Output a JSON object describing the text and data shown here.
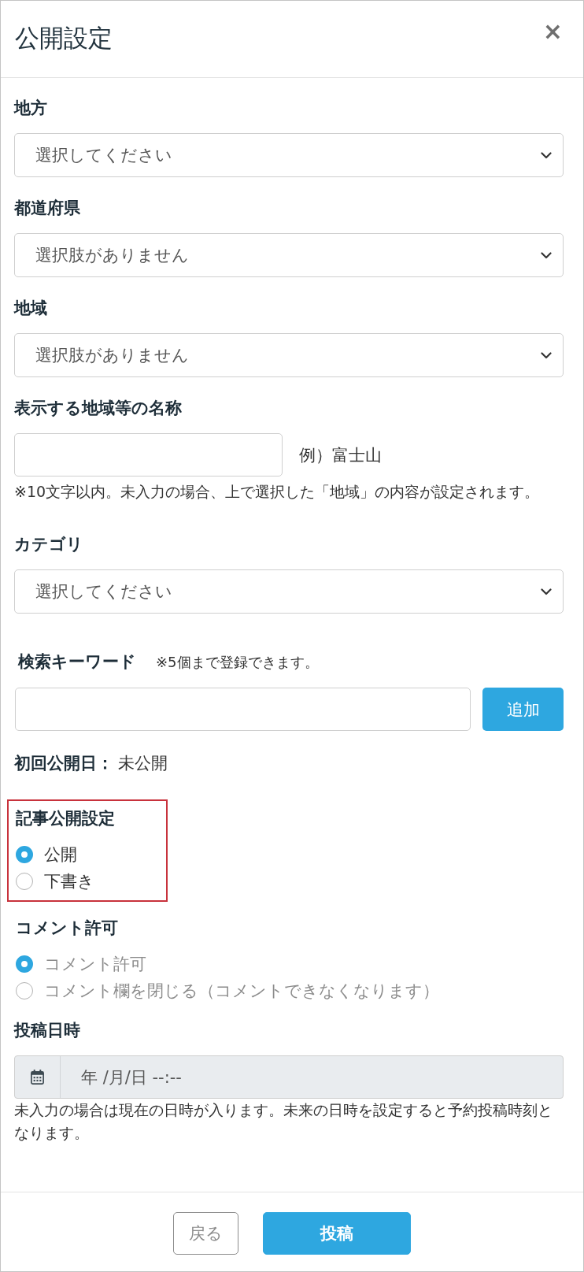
{
  "dialog": {
    "title": "公開設定",
    "close": "×"
  },
  "fields": [
    {
      "kind": "select",
      "label": "地方",
      "value": "選択してください"
    },
    {
      "kind": "select",
      "label": "都道府県",
      "value": "選択肢がありません"
    },
    {
      "kind": "select",
      "label": "地域",
      "value": "選択肢がありません"
    },
    {
      "kind": "text",
      "label": "表示する地域等の名称",
      "example": "例）富士山",
      "note": "※10文字以内。未入力の場合、上で選択した「地域」の内容が設定されます。"
    },
    {
      "kind": "select",
      "label": "カテゴリ",
      "value": "選択してください"
    },
    {
      "kind": "keywords",
      "label": "検索キーワード",
      "note": "※5個まで登録できます。",
      "button": "追加"
    },
    {
      "kind": "info",
      "label": "初回公開日：",
      "value": "未公開"
    },
    {
      "kind": "radio",
      "label": "記事公開設定",
      "highlighted": true,
      "options": [
        {
          "label": "公開",
          "selected": true,
          "disabled": false
        },
        {
          "label": "下書き",
          "selected": false,
          "disabled": false
        }
      ]
    },
    {
      "kind": "radio",
      "label": "コメント許可",
      "highlighted": false,
      "options": [
        {
          "label": "コメント許可",
          "selected": true,
          "disabled": true
        },
        {
          "label": "コメント欄を閉じる（コメントできなくなります）",
          "selected": false,
          "disabled": true
        }
      ]
    },
    {
      "kind": "datetime",
      "label": "投稿日時",
      "placeholder": "年 /月/日 --:--",
      "disabled": true,
      "note": "未入力の場合は現在の日時が入ります。未来の日時を設定すると予約投稿時刻となります。"
    }
  ],
  "footer": {
    "buttons": [
      {
        "label": "戻る",
        "kind": "secondary"
      },
      {
        "label": "投稿",
        "kind": "primary"
      }
    ]
  }
}
